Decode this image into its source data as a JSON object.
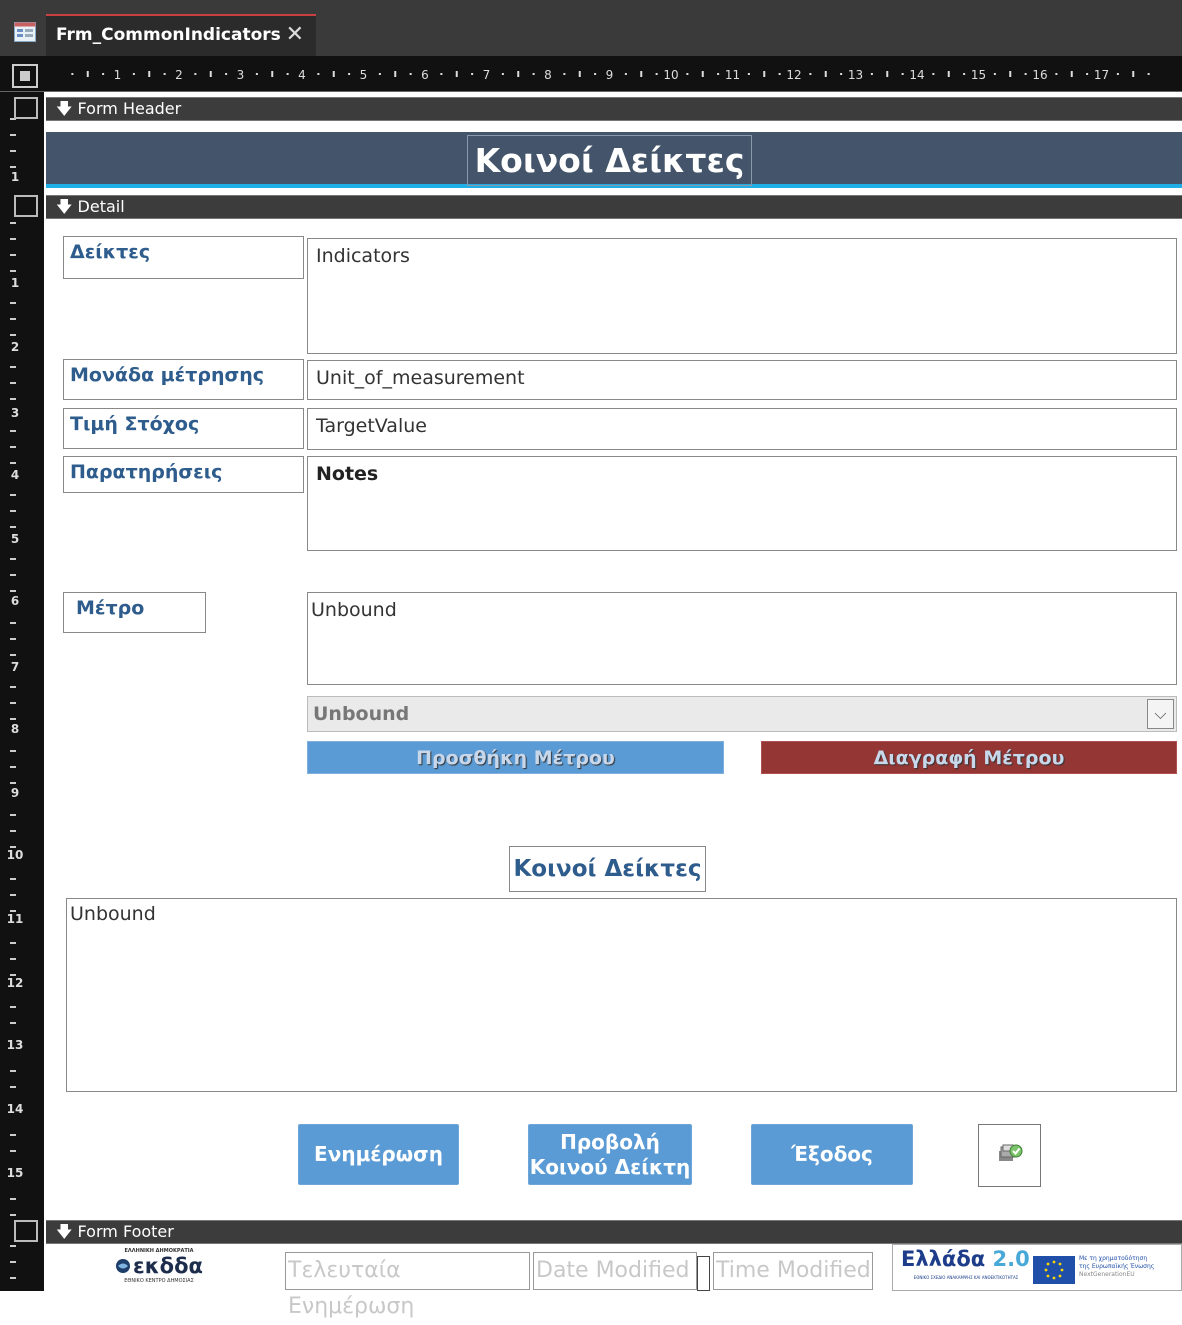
{
  "tab": {
    "title": "Frm_CommonIndicators",
    "close": "✕"
  },
  "ruler": {
    "h_labels": [
      "1",
      "2",
      "3",
      "4",
      "5",
      "6",
      "7",
      "8",
      "9",
      "10",
      "11",
      "12",
      "13",
      "14",
      "15",
      "16",
      "17"
    ],
    "v_labels": [
      "1",
      "1",
      "2",
      "3",
      "4",
      "5",
      "6",
      "7",
      "8",
      "9",
      "10",
      "11",
      "12",
      "13",
      "14",
      "15"
    ]
  },
  "sections": {
    "header": "Form Header",
    "detail": "Detail",
    "footer": "Form Footer"
  },
  "header": {
    "title": "Κοινοί Δείκτες"
  },
  "fields": {
    "indicators_label": "Δείκτες",
    "indicators_value": "Indicators",
    "unit_label": "Μονάδα μέτρησης",
    "unit_value": "Unit_of_measurement",
    "target_label": "Τιμή Στόχος",
    "target_value": "TargetValue",
    "notes_label": "Παρατηρήσεις",
    "notes_value": "Notes",
    "measure_label": "Μέτρο",
    "measure_value": "Unbound",
    "measure_combo": "Unbound"
  },
  "buttons": {
    "add_measure": "Προσθήκη Μέτρου",
    "delete_measure": "Διαγραφή Μέτρου",
    "update": "Ενημέρωση",
    "view_line1": "Προβολή",
    "view_line2": "Κοινού Δείκτη",
    "exit": "Έξοδος"
  },
  "subform": {
    "title": "Κοινοί Δείκτες",
    "value": "Unbound"
  },
  "footer": {
    "last_update_label": "Τελευταία Ενημέρωση",
    "date_modified": "Date Modified",
    "time_modified": "Time Modified",
    "logo_left_top": "ΕΛΛΗΝΙΚΗ ΔΗΜΟΚΡΑΤΙΑ",
    "logo_left_name": "εκδδα",
    "logo_left_sub": "ΕΘΝΙΚΟ ΚΕΝΤΡΟ ΔΗΜΟΣΙΑΣ",
    "logo_right_name": "Ελλάδα",
    "logo_right_version": "2.0",
    "logo_right_sub": "ΕΘΝΙΚΟ ΣΧΕΔΙΟ ΑΝΑΚΑΜΨΗΣ ΚΑΙ ΑΝΘΕΚΤΙΚΟΤΗΤΑΣ",
    "eu_line1": "Με τη χρηματοδότηση",
    "eu_line2": "της Ευρωπαϊκής Ένωσης",
    "eu_line3": "NextGenerationEU"
  },
  "colors": {
    "header_band": "#44546a",
    "accent_line": "#1faee6",
    "label_text": "#2e5c8c",
    "button_blue": "#5b9bd5",
    "button_red": "#943634"
  }
}
